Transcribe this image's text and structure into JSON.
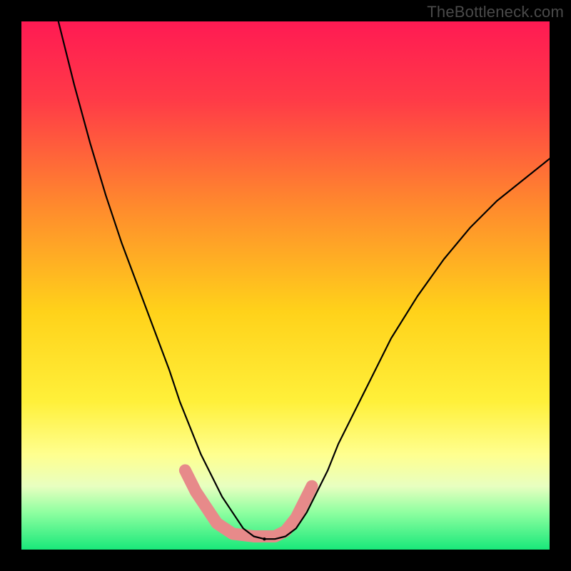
{
  "watermark": "TheBottleneck.com",
  "chart_data": {
    "type": "line",
    "title": "",
    "xlabel": "",
    "ylabel": "",
    "xlim": [
      0,
      100
    ],
    "ylim": [
      0,
      100
    ],
    "grid": false,
    "legend": false,
    "background_gradient": {
      "stops": [
        {
          "pos": 0.0,
          "color": "#ff1a53"
        },
        {
          "pos": 0.15,
          "color": "#ff3b47"
        },
        {
          "pos": 0.35,
          "color": "#ff8a2d"
        },
        {
          "pos": 0.55,
          "color": "#ffd21a"
        },
        {
          "pos": 0.72,
          "color": "#fff03a"
        },
        {
          "pos": 0.82,
          "color": "#ffff8f"
        },
        {
          "pos": 0.88,
          "color": "#e8ffc0"
        },
        {
          "pos": 0.93,
          "color": "#8effa0"
        },
        {
          "pos": 1.0,
          "color": "#19e87a"
        }
      ]
    },
    "green_band_y": [
      91,
      100
    ],
    "series": [
      {
        "name": "bottleneck-curve",
        "color": "#000000",
        "stroke_width": 2.2,
        "x": [
          7,
          10,
          13,
          16,
          19,
          22,
          25,
          28,
          30,
          32,
          34,
          36,
          38,
          40,
          42,
          44,
          46,
          48,
          50,
          52,
          54,
          56,
          58,
          60,
          63,
          66,
          70,
          75,
          80,
          85,
          90,
          95,
          100
        ],
        "values": [
          0,
          12,
          23,
          33,
          42,
          50,
          58,
          66,
          72,
          77,
          82,
          86,
          90,
          93,
          96,
          97.5,
          98,
          98,
          97.5,
          96,
          93,
          89,
          85,
          80,
          74,
          68,
          60,
          52,
          45,
          39,
          34,
          30,
          26
        ]
      },
      {
        "name": "bottom-marker-segment",
        "color": "#e78a8a",
        "stroke_width": 17,
        "linecap": "round",
        "x": [
          31,
          33,
          35,
          37,
          40,
          44,
          48,
          50,
          52,
          53.5,
          55
        ],
        "values": [
          85,
          89,
          92,
          95,
          97,
          97.5,
          97.5,
          96.5,
          94,
          91,
          88
        ]
      }
    ],
    "vertex_dot": {
      "x": 46,
      "y": 98,
      "r": 2.2,
      "color": "#000000"
    }
  }
}
